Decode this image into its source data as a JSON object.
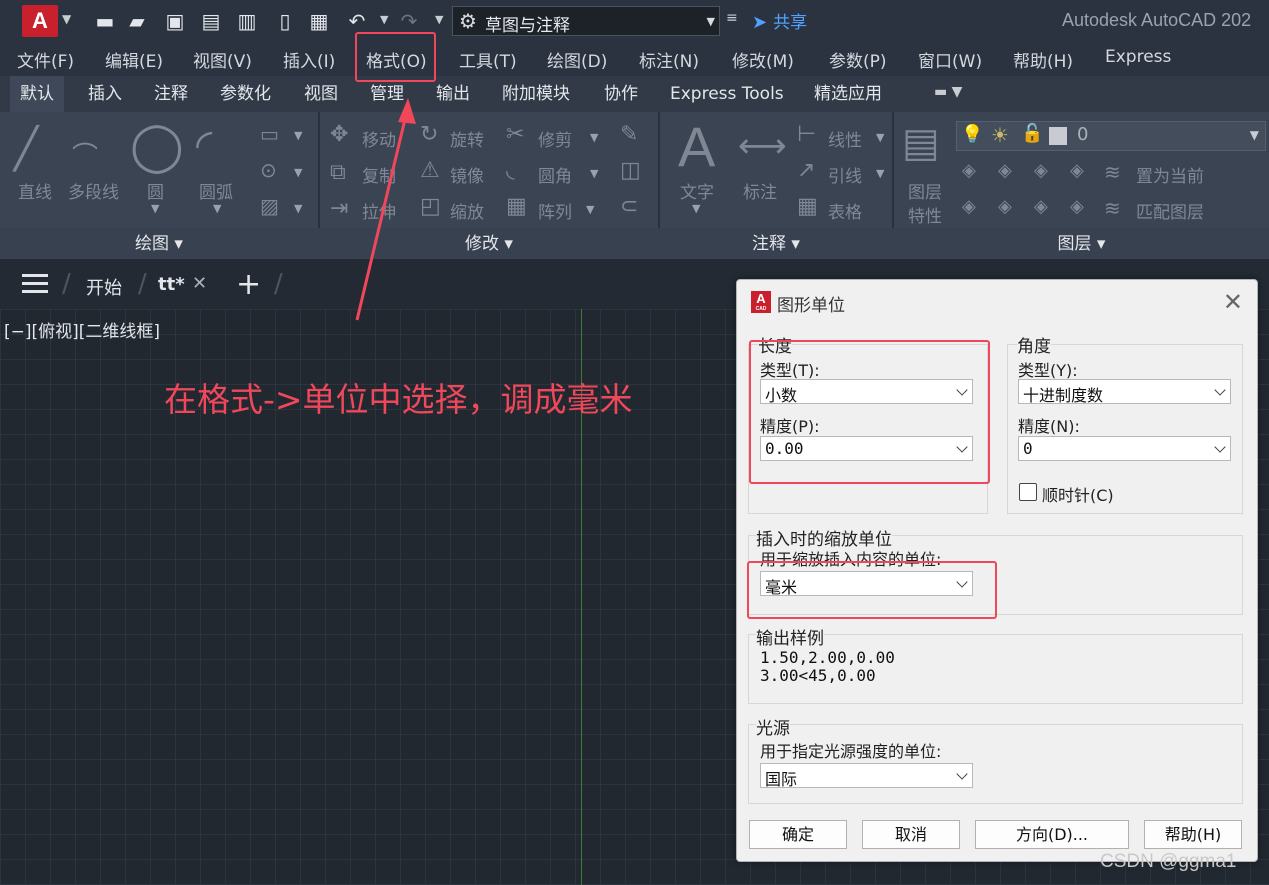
{
  "app": {
    "logo_letter": "A",
    "title": "Autodesk AutoCAD 202",
    "workspace": "草图与注释",
    "share_label": "共享"
  },
  "menu": [
    "文件(F)",
    "编辑(E)",
    "视图(V)",
    "插入(I)",
    "格式(O)",
    "工具(T)",
    "绘图(D)",
    "标注(N)",
    "修改(M)",
    "参数(P)",
    "窗口(W)",
    "帮助(H)",
    "Express"
  ],
  "ribbon_tabs": [
    "默认",
    "插入",
    "注释",
    "参数化",
    "视图",
    "管理",
    "输出",
    "附加模块",
    "协作",
    "Express Tools",
    "精选应用"
  ],
  "ribbon": {
    "draw": {
      "title": "绘图",
      "line": "直线",
      "polyline": "多段线",
      "circle": "圆",
      "arc": "圆弧"
    },
    "modify": {
      "title": "修改",
      "move": "移动",
      "rotate": "旋转",
      "trim": "修剪",
      "copy": "复制",
      "mirror": "镜像",
      "fillet": "圆角",
      "stretch": "拉伸",
      "scale": "缩放",
      "array": "阵列"
    },
    "annotation": {
      "title": "注释",
      "text": "文字",
      "dimension": "标注",
      "linear": "线性",
      "leader": "引线",
      "table": "表格"
    },
    "layers": {
      "title": "图层",
      "properties_1": "图层",
      "properties_2": "特性",
      "current_layer": "0",
      "set_current": "置为当前",
      "match_layer": "匹配图层"
    }
  },
  "doc_tabs": {
    "start": "开始",
    "active": "tt*"
  },
  "canvas": {
    "viewport_label": "[−][俯视][二维线框]",
    "annotation": "在格式->单位中选择，调成毫米"
  },
  "dialog": {
    "title": "图形单位",
    "length": {
      "group": "长度",
      "type_label": "类型(T):",
      "type_value": "小数",
      "precision_label": "精度(P):",
      "precision_value": "0.00"
    },
    "angle": {
      "group": "角度",
      "type_label": "类型(Y):",
      "type_value": "十进制度数",
      "precision_label": "精度(N):",
      "precision_value": "0",
      "clockwise_label": "顺时针(C)",
      "clockwise_checked": false
    },
    "insertion": {
      "group": "插入时的缩放单位",
      "label": "用于缩放插入内容的单位:",
      "value": "毫米"
    },
    "sample": {
      "group": "输出样例",
      "line1": "1.50,2.00,0.00",
      "line2": "3.00<45,0.00"
    },
    "lighting": {
      "group": "光源",
      "label": "用于指定光源强度的单位:",
      "value": "国际"
    },
    "buttons": {
      "ok": "确定",
      "cancel": "取消",
      "direction": "方向(D)...",
      "help": "帮助(H)"
    }
  },
  "watermark": "CSDN @ggma1",
  "colors": {
    "annotation_red": "#f0475a",
    "brand_red": "#c8202c",
    "share_blue": "#4fa3ff"
  }
}
